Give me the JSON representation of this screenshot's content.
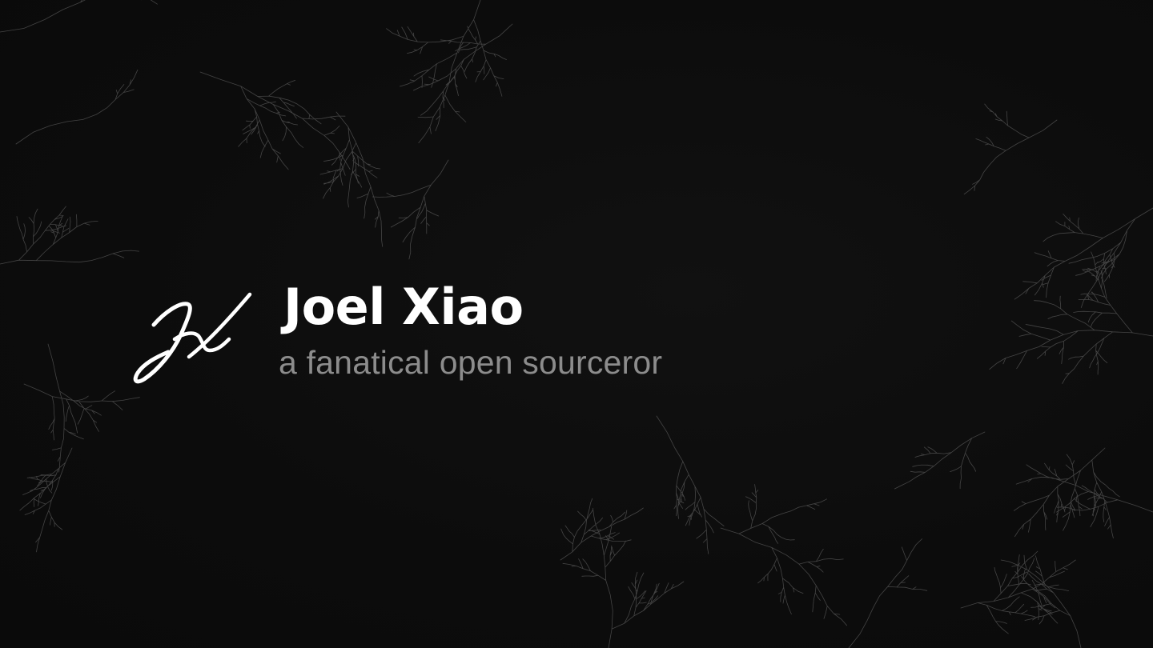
{
  "hero": {
    "logo_icon": "jx-signature-icon",
    "name": "Joel Xiao",
    "tagline": "a fanatical open sourceror"
  },
  "background": {
    "pattern": "branching-tree-lines",
    "color": "#0d0d0d",
    "line_color": "#8a8a8a"
  },
  "colors": {
    "title": "#ffffff",
    "tagline": "#8c8c8c",
    "logo": "#ffffff"
  }
}
